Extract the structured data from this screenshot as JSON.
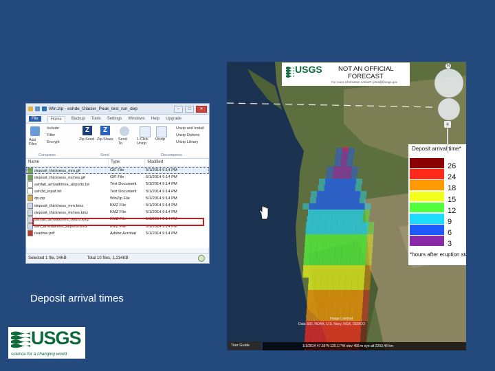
{
  "caption": "Deposit arrival times",
  "explorer": {
    "title": "Win.zip - eshde_Glacier_Peak_test_run_dep",
    "ribbon_tabs": [
      "File",
      "Home",
      "Backup",
      "Tools",
      "Settings",
      "Windows",
      "Help",
      "Upgrade"
    ],
    "ribbon_buttons": {
      "include": "Include",
      "filter": "Filter",
      "encrypt": "Encrypt",
      "add_files": "Add Files",
      "zipsend": "Zip.Send",
      "zipshare": "Zip.Share",
      "send_to": "Send To",
      "unzip_1click": "1-Click Unzip",
      "unzip": "Unzip",
      "unzip_and_install": "Unzip and Install",
      "unzip_options": "Unzip Options",
      "unzip_to": "Unzip Library"
    },
    "ribbon_groups": [
      "Compress",
      "Send",
      "Decompress"
    ],
    "columns": [
      "Name",
      "Type",
      "Modified"
    ],
    "files": [
      {
        "name": "deposit_thickness_mm.gif",
        "type": "GIF File",
        "modified": "5/1/2014 9:14 PM",
        "icon": "gif-icon"
      },
      {
        "name": "deposit_thickness_inches.gif",
        "type": "GIF File",
        "modified": "5/1/2014 9:14 PM",
        "icon": "gif-icon"
      },
      {
        "name": "ashfall_arrivaltimes_airports.txt",
        "type": "Text Document",
        "modified": "5/1/2014 9:14 PM",
        "icon": "txt-icon"
      },
      {
        "name": "ash3d_input.txt",
        "type": "Text Document",
        "modified": "5/1/2014 9:14 PM",
        "icon": "txt-icon"
      },
      {
        "name": "dp.zip",
        "type": "WinZip File",
        "modified": "5/1/2014 9:14 PM",
        "icon": "zip-icon"
      },
      {
        "name": "deposit_thickness_mm.kmz",
        "type": "KMZ File",
        "modified": "5/1/2014 9:14 PM",
        "icon": "kmz-icon"
      },
      {
        "name": "deposit_thickness_inches.kmz",
        "type": "KMZ File",
        "modified": "5/1/2014 9:14 PM",
        "icon": "kmz-icon"
      },
      {
        "name": "ashfall_arrivaltimes_hours.kmz",
        "type": "KMZ File",
        "modified": "5/1/2014 9:14 PM",
        "icon": "kmz-icon"
      },
      {
        "name": "ash_arrivaltimes_airports.kmz",
        "type": "KMZ File",
        "modified": "5/1/2014 9:14 PM",
        "icon": "kmz-icon"
      },
      {
        "name": "readme.pdf",
        "type": "Adobe Acrobat",
        "modified": "5/1/2014 9:14 PM",
        "icon": "pdf-icon"
      }
    ],
    "status_selected": "Selected 1 file, 34KB",
    "status_total": "Total 10 files, 1,234KB"
  },
  "usgs_logo": {
    "word": "USGS",
    "tagline": "science for a changing world"
  },
  "map": {
    "notice_logo_word": "USGS",
    "notice_line1": "NOT AN OFFICIAL",
    "notice_line2": "FORECAST",
    "notice_small": "For more information contact: [email]@usgs.gov",
    "legend_title": "Deposit arrival time*",
    "legend_labels": [
      "26",
      "24",
      "18",
      "15",
      "12",
      "9",
      "6",
      "3"
    ],
    "legend_note": "*hours after eruption start",
    "legend_colors": [
      "#8b0000",
      "#ff2a1a",
      "#ff9a00",
      "#f2ff1a",
      "#52ff3c",
      "#1edcff",
      "#1b5bff",
      "#8a2aa8"
    ],
    "attribution_line1": "Image Landsat",
    "attribution_line2": "Data SIO, NOAA, U.S. Navy, NGA, GEBCO",
    "status_line": "1/1/2014 47.35°N 120.17°W elev 455 m eye alt 2203.46 km",
    "tour_guide": "Tour Guide",
    "plume_level": "arrival times spread from ~3 h near vent to ~26 h south"
  }
}
